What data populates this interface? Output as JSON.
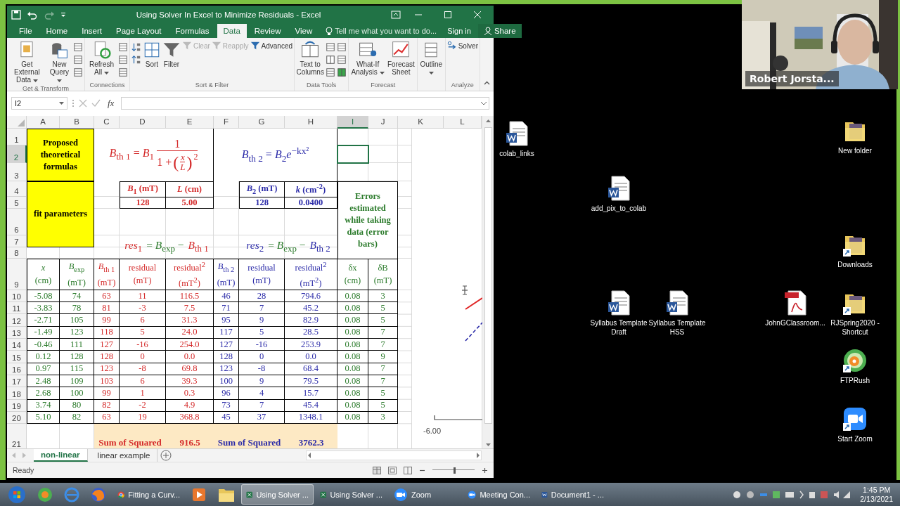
{
  "window": {
    "title": "Using Solver In Excel to Minimize Residuals - Excel"
  },
  "tabs": [
    {
      "label": "File",
      "selected": false
    },
    {
      "label": "Home",
      "selected": false
    },
    {
      "label": "Insert",
      "selected": false
    },
    {
      "label": "Page Layout",
      "selected": false
    },
    {
      "label": "Formulas",
      "selected": false
    },
    {
      "label": "Data",
      "selected": true
    },
    {
      "label": "Review",
      "selected": false
    },
    {
      "label": "View",
      "selected": false
    }
  ],
  "tell_me": {
    "placeholder": "Tell me what you want to do..."
  },
  "sign_in": "Sign in",
  "share": "Share",
  "ribbon": {
    "groups": [
      {
        "label": "Get & Transform",
        "items": [
          {
            "kind": "large",
            "label": "Get External Data",
            "dropdown": true
          },
          {
            "kind": "large",
            "label": "New Query",
            "dropdown": true
          },
          {
            "kind": "stack"
          }
        ]
      },
      {
        "label": "Connections",
        "items": [
          {
            "kind": "large",
            "label": "Refresh All",
            "dropdown": true
          },
          {
            "kind": "stack"
          }
        ]
      },
      {
        "label": "Sort & Filter",
        "items": [
          {
            "kind": "stack"
          },
          {
            "kind": "large",
            "label": "Sort",
            "dropdown": false
          },
          {
            "kind": "large",
            "label": "Filter",
            "dropdown": false
          },
          {
            "kind": "small",
            "label": "Clear",
            "disabled": true
          },
          {
            "kind": "small",
            "label": "Reapply",
            "disabled": true
          },
          {
            "kind": "small",
            "label": "Advanced",
            "disabled": false
          }
        ]
      },
      {
        "label": "Data Tools",
        "items": [
          {
            "kind": "large",
            "label": "Text to Columns",
            "dropdown": false
          },
          {
            "kind": "stack"
          },
          {
            "kind": "stack"
          }
        ]
      },
      {
        "label": "Forecast",
        "items": [
          {
            "kind": "large",
            "label": "What-If Analysis",
            "dropdown": true
          },
          {
            "kind": "large",
            "label": "Forecast Sheet",
            "dropdown": false
          }
        ]
      },
      {
        "items": [
          {
            "kind": "large",
            "label": "Outline",
            "dropdown": true
          }
        ]
      },
      {
        "label": "Analyze",
        "items": [
          {
            "kind": "small",
            "label": "Solver",
            "disabled": false
          }
        ]
      }
    ]
  },
  "formula_bar": {
    "name_box": "I2",
    "function_label": "fx"
  },
  "sheet": {
    "column_headers": [
      {
        "label": "A",
        "selected": false
      },
      {
        "label": "B",
        "selected": false
      },
      {
        "label": "C",
        "selected": false
      },
      {
        "label": "D",
        "selected": false
      },
      {
        "label": "E",
        "selected": false
      },
      {
        "label": "F",
        "selected": false
      },
      {
        "label": "G",
        "selected": false
      },
      {
        "label": "H",
        "selected": false
      },
      {
        "label": "I",
        "selected": true
      },
      {
        "label": "J",
        "selected": false
      },
      {
        "label": "K",
        "selected": false
      },
      {
        "label": "L",
        "selected": false
      }
    ],
    "row_headers": [
      {
        "label": "1",
        "selected": false
      },
      {
        "label": "2",
        "selected": true
      },
      {
        "label": "3",
        "selected": false
      },
      {
        "label": "4",
        "selected": false
      },
      {
        "label": "5",
        "selected": false
      },
      {
        "label": "6",
        "selected": false
      },
      {
        "label": "7",
        "selected": false
      },
      {
        "label": "8",
        "selected": false
      },
      {
        "label": "9",
        "selected": false
      },
      {
        "label": "10",
        "selected": false
      },
      {
        "label": "11",
        "selected": false
      },
      {
        "label": "12",
        "selected": false
      },
      {
        "label": "13",
        "selected": false
      },
      {
        "label": "14",
        "selected": false
      },
      {
        "label": "15",
        "selected": false
      },
      {
        "label": "16",
        "selected": false
      },
      {
        "label": "17",
        "selected": false
      },
      {
        "label": "18",
        "selected": false
      },
      {
        "label": "19",
        "selected": false
      },
      {
        "label": "20",
        "selected": false
      },
      {
        "label": "21",
        "selected": false
      }
    ],
    "header_block": {
      "formulas_label": "Proposed theoretical formulas",
      "params_label": "fit parameters",
      "formula_1": {
        "color": "#d42a2a",
        "lhs": "*B*$_{th 1}$ = *B*$_{1}$",
        "numerator": "1",
        "denominator": "1 +",
        "open": "(",
        "inner_numerator": "x",
        "inner_denominator": "L",
        "close": ")",
        "exponent": "2"
      },
      "formula_2": {
        "color": "#2a2aa8",
        "text": "*B*$_{th 2}$ = *B*$_{2}$*e*$^{−kx²}$"
      },
      "params_1": {
        "color": "#d42a2a",
        "items": [
          {
            "label": "*B*$_{1}$ (mT)",
            "value": "128"
          },
          {
            "label": "*L* (cm)",
            "value": "5.00"
          }
        ]
      },
      "params_2": {
        "color": "#2a2aa8",
        "items": [
          {
            "label": "*B*$_{2}$ (mT)",
            "value": "128"
          },
          {
            "label": "*k* (cm$^{-2}$)",
            "value": "0.0400"
          }
        ]
      },
      "errors_note": "Errors estimated while taking data (error bars)",
      "residual_1": [
        {
          "text": "*res*$_{1}$",
          "color": "#d42a2a"
        },
        {
          "text": "= *B*$_{exp}$ −",
          "color": "#2a7a2a"
        },
        {
          "text": "*B*$_{th 1}$",
          "color": "#d42a2a"
        }
      ],
      "residual_2": [
        {
          "text": "*res*$_{2}$",
          "color": "#2a2aa8"
        },
        {
          "text": "= *B*$_{exp}$ −",
          "color": "#2a7a2a"
        },
        {
          "text": "*B*$_{th 2}$",
          "color": "#2a2aa8"
        }
      ]
    },
    "columns": [
      {
        "header": "*x*",
        "unit": "(cm)",
        "color": "#2a7a2a"
      },
      {
        "header": "*B*$_{exp}$",
        "unit": "(mT)",
        "color": "#2a7a2a"
      },
      {
        "header": "*B*$_{th 1}$",
        "unit": "(mT)",
        "color": "#d42a2a"
      },
      {
        "header": "residual",
        "unit": "(mT)",
        "color": "#d42a2a"
      },
      {
        "header": "residual$^{2}$",
        "unit": "(mT$^{2}$)",
        "color": "#d42a2a"
      },
      {
        "header": "*B*$_{th 2}$",
        "unit": "(mT)",
        "color": "#2a2aa8"
      },
      {
        "header": "residual",
        "unit": "(mT)",
        "color": "#2a2aa8"
      },
      {
        "header": "residual$^{2}$",
        "unit": "(mT$^{2}$)",
        "color": "#2a2aa8"
      },
      {
        "header": "δx",
        "unit": "(cm)",
        "color": "#2a7a2a"
      },
      {
        "header": "δB",
        "unit": "(mT)",
        "color": "#2a7a2a"
      }
    ],
    "rows": [
      [
        "-5.08",
        "74",
        "63",
        "11",
        "116.5",
        "46",
        "28",
        "794.6",
        "0.08",
        "3"
      ],
      [
        "-3.83",
        "78",
        "81",
        "-3",
        "7.5",
        "71",
        "7",
        "45.2",
        "0.08",
        "5"
      ],
      [
        "-2.71",
        "105",
        "99",
        "6",
        "31.3",
        "95",
        "9",
        "82.9",
        "0.08",
        "5"
      ],
      [
        "-1.49",
        "123",
        "118",
        "5",
        "24.0",
        "117",
        "5",
        "28.5",
        "0.08",
        "7"
      ],
      [
        "-0.46",
        "111",
        "127",
        "-16",
        "254.0",
        "127",
        "-16",
        "253.9",
        "0.08",
        "7"
      ],
      [
        "0.12",
        "128",
        "128",
        "0",
        "0.0",
        "128",
        "0",
        "0.0",
        "0.08",
        "9"
      ],
      [
        "0.97",
        "115",
        "123",
        "-8",
        "69.8",
        "123",
        "-8",
        "68.4",
        "0.08",
        "7"
      ],
      [
        "2.48",
        "109",
        "103",
        "6",
        "39.3",
        "100",
        "9",
        "79.5",
        "0.08",
        "7"
      ],
      [
        "2.68",
        "100",
        "99",
        "1",
        "0.3",
        "96",
        "4",
        "15.7",
        "0.08",
        "5"
      ],
      [
        "3.74",
        "80",
        "82",
        "-2",
        "4.9",
        "73",
        "7",
        "45.4",
        "0.08",
        "5"
      ],
      [
        "5.10",
        "82",
        "63",
        "19",
        "368.8",
        "45",
        "37",
        "1348.1",
        "0.08",
        "3"
      ]
    ],
    "sums": [
      {
        "label": "Sum of Squared",
        "value": "916.5",
        "color": "#d42a2a"
      },
      {
        "label": "Sum of Squared",
        "value": "3762.3",
        "color": "#2a2aa8"
      }
    ],
    "chart": {
      "axis_label": "-6.00"
    }
  },
  "sheet_tabs": [
    {
      "label": "non-linear",
      "selected": true
    },
    {
      "label": "linear example",
      "selected": false
    }
  ],
  "status_bar": {
    "text": "Ready",
    "zoom_slider": {
      "level": 0.52
    }
  },
  "desktop_icons": [
    {
      "kind": "document",
      "label": "colab_links",
      "shortcut": false
    },
    {
      "kind": "folder",
      "label": "New folder",
      "shortcut": false
    },
    {
      "kind": "document",
      "label": "add_pix_to_colab",
      "shortcut": false
    },
    {
      "kind": "folder",
      "label": "Downloads",
      "shortcut": true
    },
    {
      "kind": "document",
      "label": "Syllabus Template Draft",
      "shortcut": false
    },
    {
      "kind": "document",
      "label": "Syllabus Template HSS",
      "shortcut": false
    },
    {
      "kind": "pdf",
      "label": "JohnGClassroom...",
      "shortcut": false
    },
    {
      "kind": "folder",
      "label": "RJSpring2020 - Shortcut",
      "shortcut": true
    },
    {
      "kind": "disc",
      "label": "FTPRush",
      "shortcut": true
    },
    {
      "kind": "camera",
      "label": "Start Zoom",
      "shortcut": true
    }
  ],
  "video": {
    "kind": "picture",
    "name": "Robert Jorsta..."
  },
  "taskbar": {
    "items": [
      {
        "kind": "start",
        "selected": false
      },
      {
        "kind": "sync",
        "selected": false
      },
      {
        "kind": "globe",
        "selected": false
      },
      {
        "kind": "fox",
        "selected": false
      },
      {
        "kind": "chrome",
        "label": "Fitting a Curv...",
        "selected": false
      },
      {
        "kind": "player",
        "selected": false
      },
      {
        "kind": "folder",
        "selected": false
      },
      {
        "kind": "sheet",
        "label": "Using Solver ...",
        "selected": true
      },
      {
        "kind": "sheet",
        "label": "Using Solver ...",
        "selected": false
      },
      {
        "kind": "camera",
        "label": "Zoom",
        "selected": false
      },
      {
        "kind": "camera",
        "label": "Meeting Con...",
        "selected": false
      },
      {
        "kind": "document",
        "label": "Document1 - ...",
        "selected": false
      }
    ],
    "time": "1:45 PM",
    "date": "2/13/2021"
  }
}
